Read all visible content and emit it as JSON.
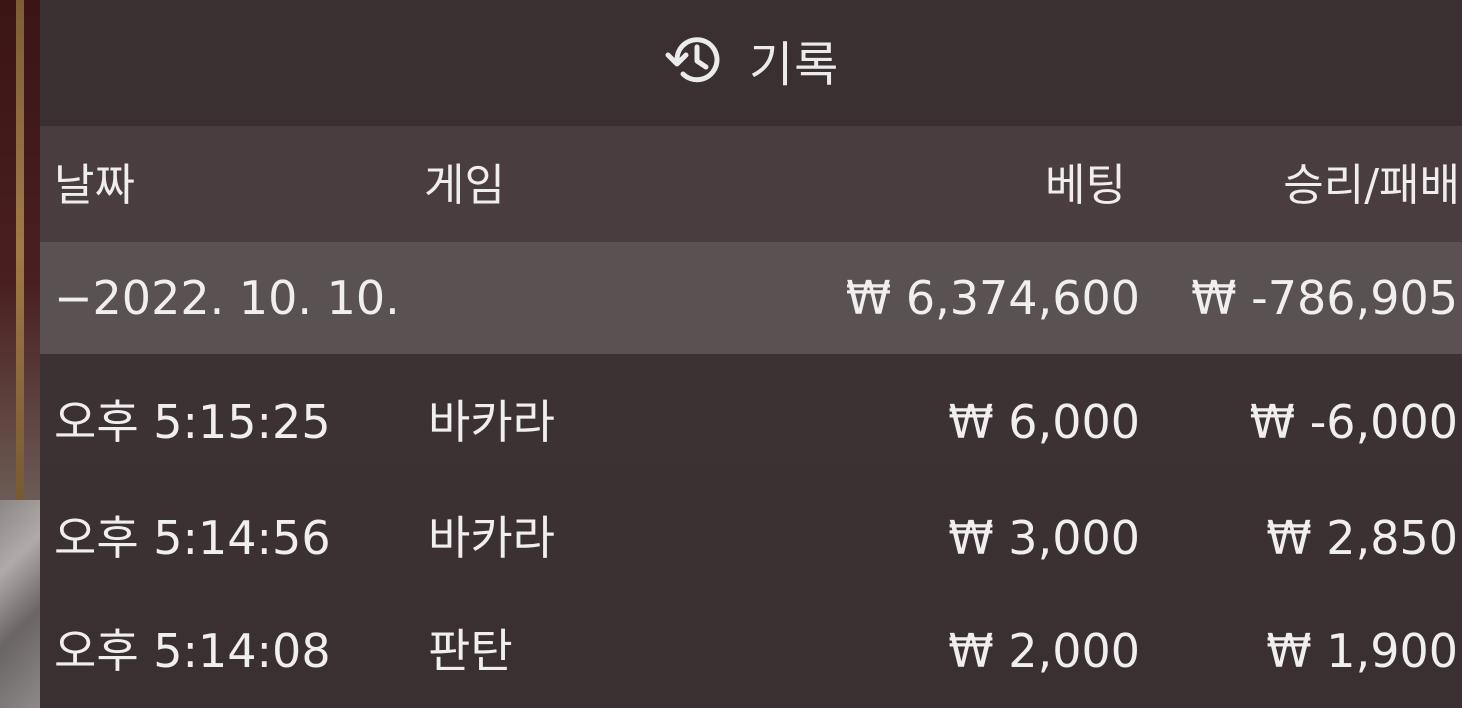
{
  "header": {
    "title": "기록",
    "icon": "history-icon"
  },
  "columns": {
    "date": "날짜",
    "game": "게임",
    "bet": "베팅",
    "win_loss": "승리/패배"
  },
  "date_group": {
    "label": "−2022. 10. 10.",
    "bet_total": "₩ 6,374,600",
    "win_loss_total": "₩ -786,905"
  },
  "rows": [
    {
      "time": "오후 5:15:25",
      "game": "바카라",
      "bet": "₩ 6,000",
      "win_loss": "₩ -6,000"
    },
    {
      "time": "오후 5:14:56",
      "game": "바카라",
      "bet": "₩ 3,000",
      "win_loss": "₩ 2,850"
    },
    {
      "time": "오후 5:14:08",
      "game": "판탄",
      "bet": "₩ 2,000",
      "win_loss": "₩ 1,900"
    }
  ]
}
